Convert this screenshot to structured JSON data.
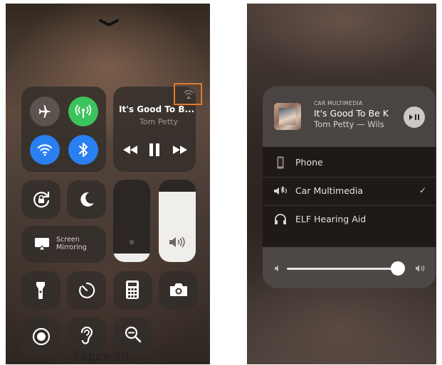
{
  "left": {
    "now_playing": {
      "title": "It's Good To B...",
      "artist": "Tom Petty"
    },
    "screen_mirroring": {
      "line1": "Screen",
      "line2": "Mirroring"
    },
    "brightness": {
      "level_percent": 10
    },
    "volume": {
      "level_percent": 85
    },
    "caption": "Figure 28",
    "colors": {
      "green": "#3cc45c",
      "blue": "#2a80f0",
      "highlight": "#e07a2e",
      "airplane_bg": "#5c534e"
    },
    "icons": {
      "dismiss": "chevron-down-icon",
      "airplane": "airplane-icon",
      "cellular": "cellular-data-icon",
      "wifi": "wifi-icon",
      "bluetooth": "bluetooth-icon",
      "airplay": "airplay-icon",
      "rewind": "rewind-icon",
      "pause": "pause-icon",
      "forward": "fast-forward-icon",
      "rotation_lock": "rotation-lock-icon",
      "do_not_disturb": "moon-icon",
      "mirroring": "screen-mirroring-icon",
      "flashlight": "flashlight-icon",
      "timer": "timer-icon",
      "calculator": "calculator-icon",
      "camera": "camera-icon",
      "record": "screen-record-icon",
      "hearing": "hearing-icon",
      "magnifier": "magnifier-icon"
    }
  },
  "right": {
    "header": {
      "source": "CAR MULTIMEDIA",
      "title": "It's Good To Be K",
      "artist": "Tom Petty — Wils"
    },
    "routes": [
      {
        "label": "Phone",
        "icon": "phone-icon",
        "selected": false
      },
      {
        "label": "Car Multimedia",
        "icon": "car-audio-icon",
        "selected": true
      },
      {
        "label": "ELF Hearing Aid",
        "icon": "headphones-icon",
        "selected": false
      }
    ],
    "checkmark": "✓",
    "volume": {
      "level_percent": 95
    }
  }
}
